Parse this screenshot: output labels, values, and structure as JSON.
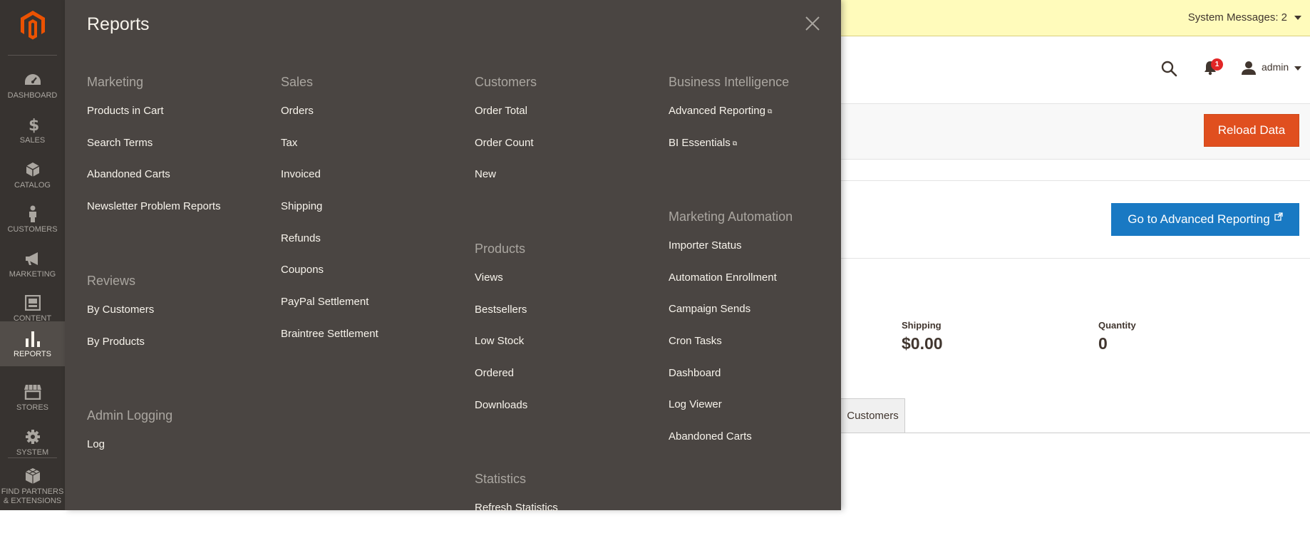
{
  "nav": {
    "items": [
      {
        "label": "DASHBOARD",
        "icon": "dashboard-icon"
      },
      {
        "label": "SALES",
        "icon": "dollar-icon"
      },
      {
        "label": "CATALOG",
        "icon": "box-icon"
      },
      {
        "label": "CUSTOMERS",
        "icon": "person-icon"
      },
      {
        "label": "MARKETING",
        "icon": "megaphone-icon"
      },
      {
        "label": "CONTENT",
        "icon": "content-icon"
      },
      {
        "label": "REPORTS",
        "icon": "bar-chart-icon"
      },
      {
        "label": "STORES",
        "icon": "store-icon"
      },
      {
        "label": "SYSTEM",
        "icon": "gear-icon"
      },
      {
        "label": "FIND PARTNERS & EXTENSIONS",
        "icon": "cubes-icon"
      }
    ],
    "active": "REPORTS"
  },
  "panel": {
    "title": "Reports",
    "columns": [
      {
        "sections": [
          {
            "title": "Marketing",
            "items": [
              "Products in Cart",
              "Search Terms",
              "Abandoned Carts",
              "Newsletter Problem Reports"
            ]
          },
          {
            "title": "Reviews",
            "items": [
              "By Customers",
              "By Products"
            ]
          },
          {
            "title": "Admin Logging",
            "items": [
              "Log"
            ]
          }
        ]
      },
      {
        "sections": [
          {
            "title": "Sales",
            "items": [
              "Orders",
              "Tax",
              "Invoiced",
              "Shipping",
              "Refunds",
              "Coupons",
              "PayPal Settlement",
              "Braintree Settlement"
            ]
          }
        ]
      },
      {
        "sections": [
          {
            "title": "Customers",
            "items": [
              "Order Total",
              "Order Count",
              "New"
            ]
          },
          {
            "title": "Products",
            "items": [
              "Views",
              "Bestsellers",
              "Low Stock",
              "Ordered",
              "Downloads"
            ]
          },
          {
            "title": "Statistics",
            "items": [
              "Refresh Statistics"
            ]
          }
        ]
      },
      {
        "sections": [
          {
            "title": "Business Intelligence",
            "items": [
              "Advanced Reporting",
              "BI Essentials"
            ]
          },
          {
            "title": "Marketing Automation",
            "items": [
              "Importer Status",
              "Automation Enrollment",
              "Campaign Sends",
              "Cron Tasks",
              "Dashboard",
              "Log Viewer",
              "Abandoned Carts"
            ]
          }
        ]
      }
    ]
  },
  "header": {
    "system_messages": "System Messages: 2",
    "notifications_count": "1",
    "user": "admin"
  },
  "actions": {
    "reload": "Reload Data",
    "advanced_reporting": "Go to Advanced Reporting"
  },
  "stats": {
    "shipping_label": "Shipping",
    "shipping_value": "$0.00",
    "quantity_label": "Quantity",
    "quantity_value": "0"
  },
  "tabs": {
    "customers": "Customers"
  },
  "colors": {
    "nav_bg": "#373330",
    "panel_bg": "#4a4542",
    "accent_orange": "#e04f1f",
    "accent_blue": "#1979c3",
    "message_bg": "#fffbbb"
  }
}
